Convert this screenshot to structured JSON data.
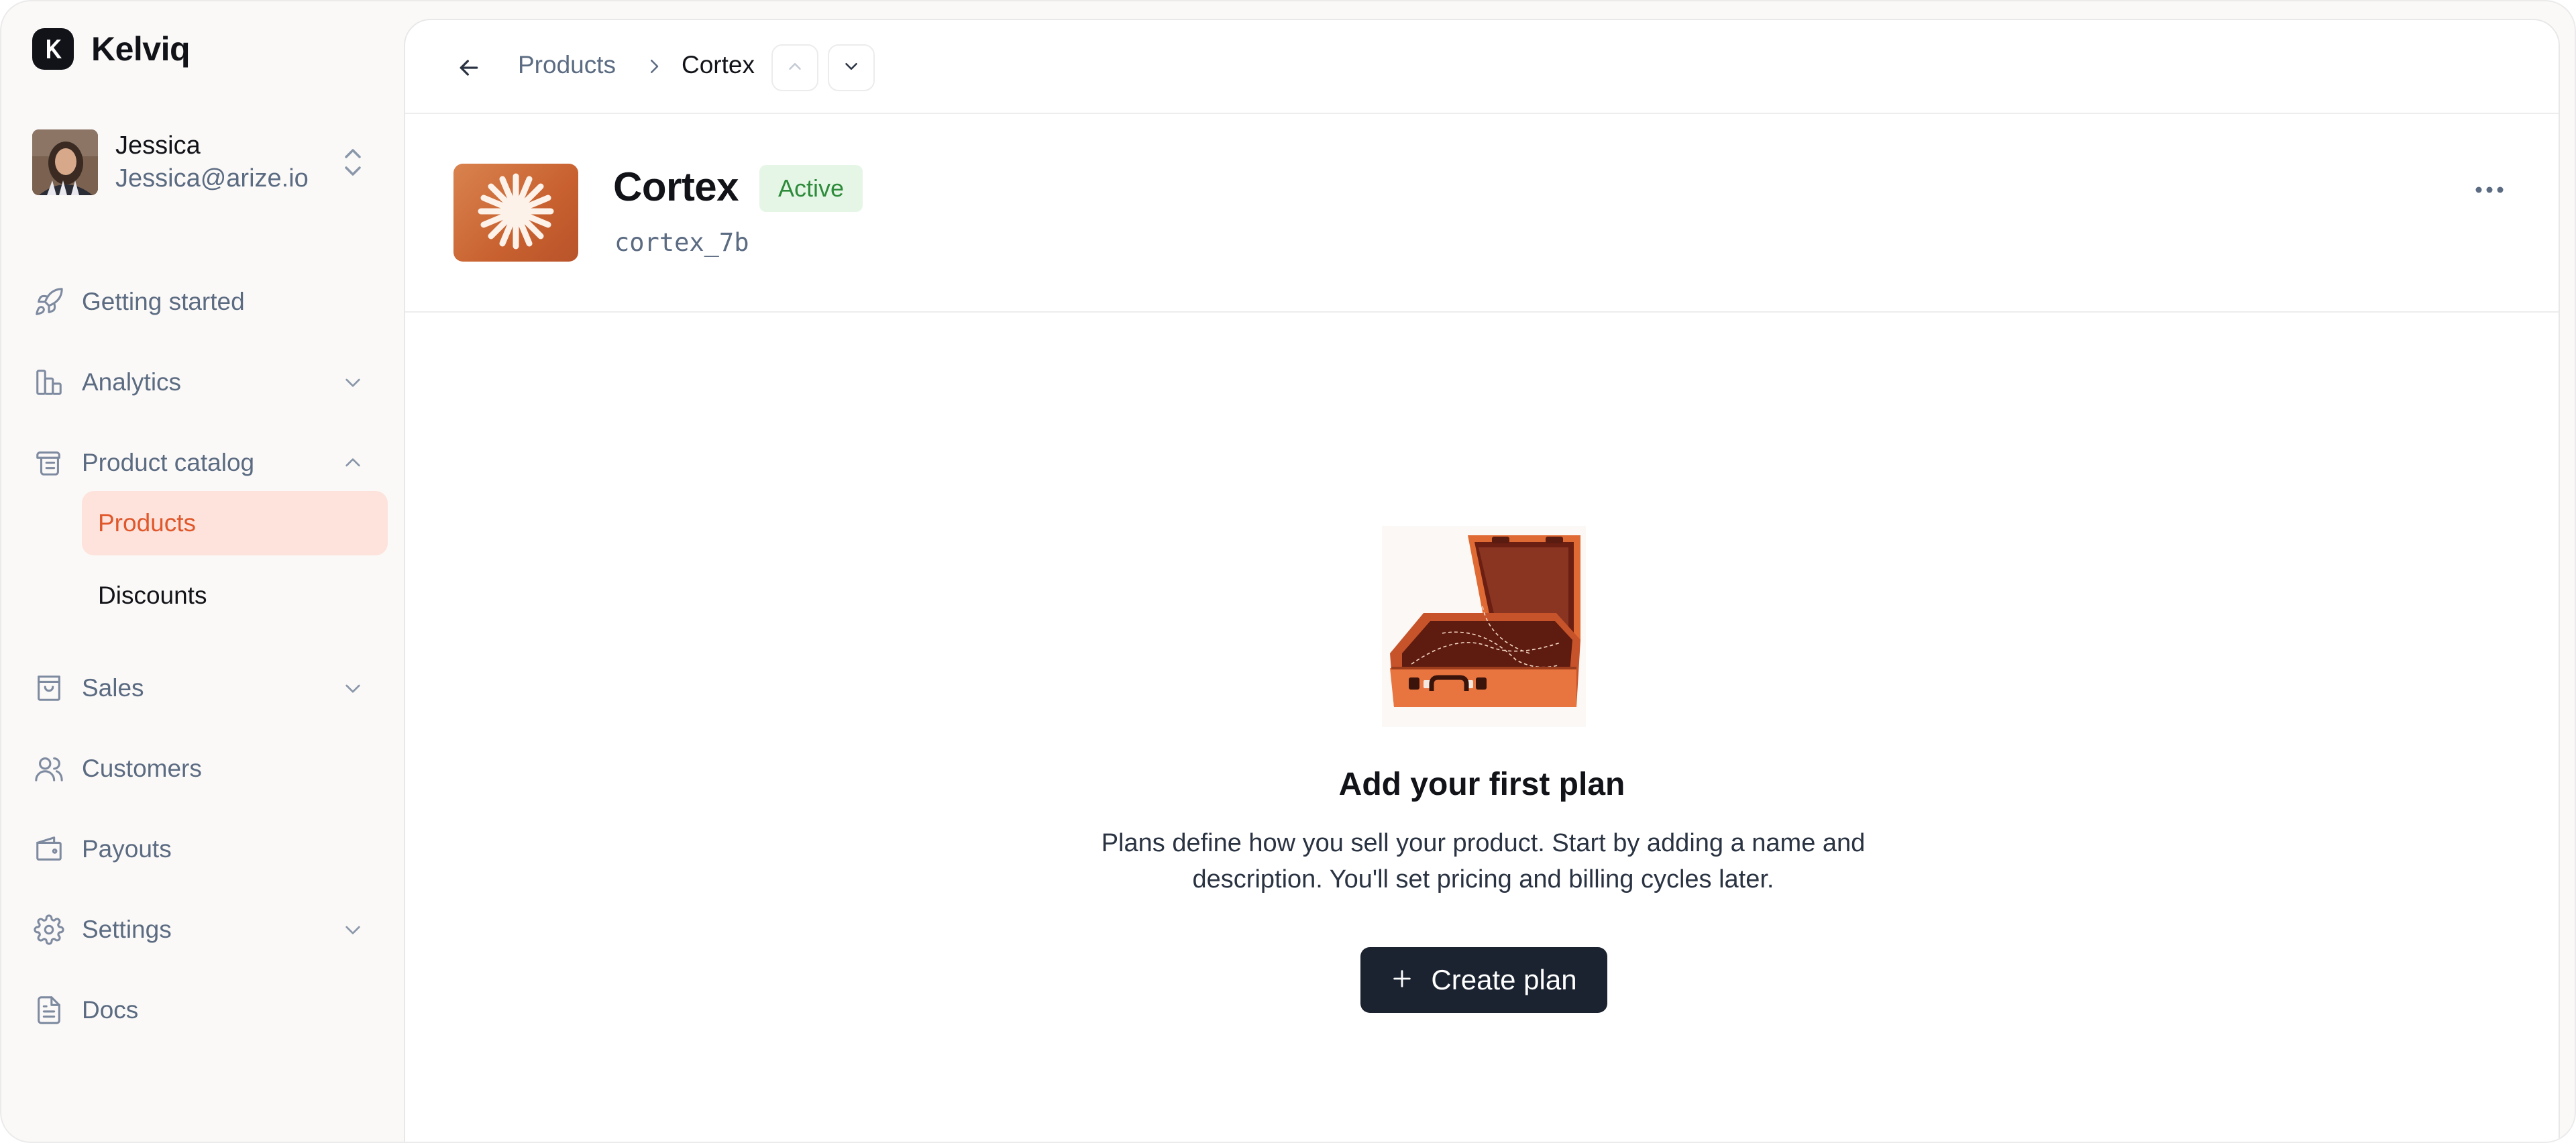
{
  "brand": {
    "name": "Kelviq",
    "logo_letter": "K"
  },
  "user": {
    "name": "Jessica",
    "email": "Jessica@arize.io"
  },
  "sidebar": {
    "items": [
      {
        "label": "Getting started",
        "icon": "rocket-icon"
      },
      {
        "label": "Analytics",
        "icon": "bar-chart-icon",
        "expandable": true,
        "expanded": false
      },
      {
        "label": "Product catalog",
        "icon": "catalog-icon",
        "expandable": true,
        "expanded": true,
        "children": [
          {
            "label": "Products",
            "active": true
          },
          {
            "label": "Discounts",
            "active": false
          }
        ]
      },
      {
        "label": "Sales",
        "icon": "shopping-bag-icon",
        "expandable": true,
        "expanded": false
      },
      {
        "label": "Customers",
        "icon": "users-icon"
      },
      {
        "label": "Payouts",
        "icon": "wallet-icon"
      },
      {
        "label": "Settings",
        "icon": "gear-icon",
        "expandable": true,
        "expanded": false
      },
      {
        "label": "Docs",
        "icon": "document-icon"
      }
    ]
  },
  "breadcrumb": {
    "parent": "Products",
    "current": "Cortex"
  },
  "product": {
    "name": "Cortex",
    "status": "Active",
    "id": "cortex_7b"
  },
  "empty_state": {
    "title": "Add your first plan",
    "description": "Plans define how you sell your product. Start by adding a name and description. You'll set pricing and billing cycles later.",
    "button_label": "Create plan"
  },
  "colors": {
    "accent": "#e0572b",
    "accent_bg": "#fde3dc",
    "status_green": "#2e8b3b",
    "status_green_bg": "#e6f6e6",
    "primary_button": "#1b2330",
    "muted_text": "#5b6b82"
  }
}
